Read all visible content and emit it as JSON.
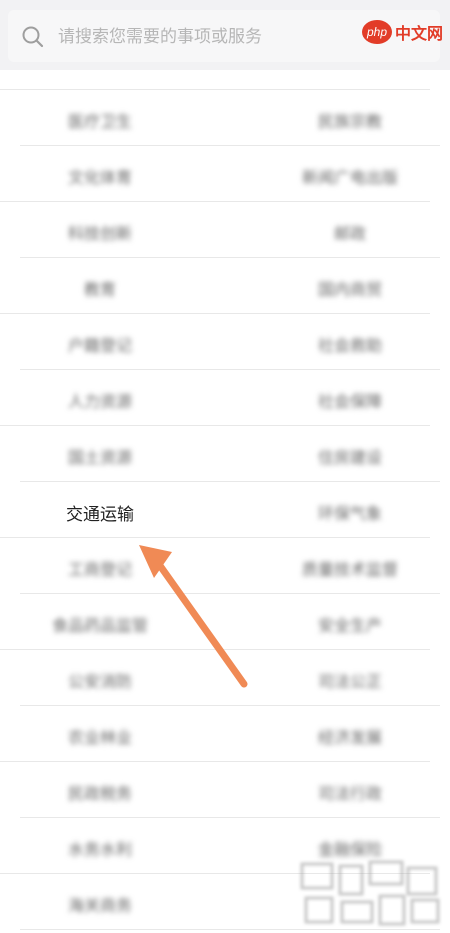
{
  "search": {
    "placeholder": "请搜索您需要的事项或服务"
  },
  "watermark": {
    "php": "php",
    "site": "中文网"
  },
  "categories": [
    {
      "left": "",
      "right": ""
    },
    {
      "left": "医疗卫生",
      "right": "民族宗教"
    },
    {
      "left": "文化体育",
      "right": "新闻广电出版"
    },
    {
      "left": "科技创新",
      "right": "邮政"
    },
    {
      "left": "教育",
      "right": "国内商贸"
    },
    {
      "left": "户籍登记",
      "right": "社会救助"
    },
    {
      "left": "人力资源",
      "right": "社会保障"
    },
    {
      "left": "国土资源",
      "right": "住房建设"
    },
    {
      "left": "交通运输",
      "right": "环保气象"
    },
    {
      "left": "工商登记",
      "right": "质量技术监督"
    },
    {
      "left": "食品药品监管",
      "right": "安全生产"
    },
    {
      "left": "公安消防",
      "right": "司法公正"
    },
    {
      "left": "农业林业",
      "right": "经济发展"
    },
    {
      "left": "民政税务",
      "right": "司法行政"
    },
    {
      "left": "水务水利",
      "right": "金融保险"
    },
    {
      "left": "海关商务",
      "right": ""
    }
  ],
  "highlighted_item": "交通运输",
  "annotation": {
    "arrow_color": "#f08a55"
  }
}
